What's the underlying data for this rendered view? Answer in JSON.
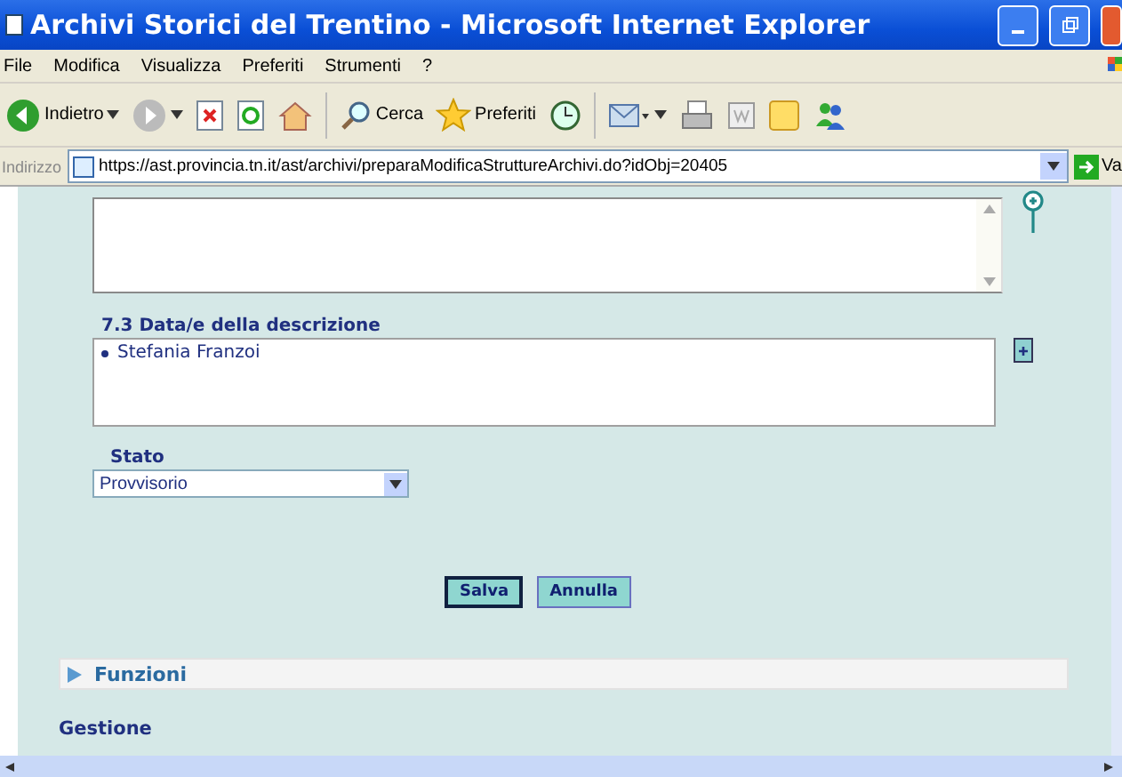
{
  "window": {
    "title": "Archivi Storici del Trentino - Microsoft Internet Explorer"
  },
  "menu": [
    "File",
    "Modifica",
    "Visualizza",
    "Preferiti",
    "Strumenti",
    "?"
  ],
  "toolbar": [
    {
      "kind": "back",
      "label": "Indietro"
    },
    {
      "kind": "forward"
    },
    {
      "kind": "stop"
    },
    {
      "kind": "refresh"
    },
    {
      "kind": "home"
    },
    {
      "kind": "search",
      "label": "Cerca"
    },
    {
      "kind": "favorites",
      "label": "Preferiti"
    },
    {
      "kind": "history"
    },
    {
      "kind": "mail"
    },
    {
      "kind": "print"
    },
    {
      "kind": "edit"
    },
    {
      "kind": "notes"
    },
    {
      "kind": "messenger"
    }
  ],
  "address": {
    "label": "Indirizzo",
    "value": "https://ast.provincia.tn.it/ast/archivi/preparaModificaStruttureArchivi.do?idObj=20405",
    "go": "Va"
  },
  "date_field": {
    "label": "7.3 Data/e della descrizione",
    "items": [
      "Stefania Franzoi"
    ]
  },
  "stato": {
    "label": "Stato",
    "value": "Provvisorio"
  },
  "buttons": [
    {
      "label": "Salva",
      "selected": true
    },
    {
      "label": "Annulla",
      "selected": false
    }
  ],
  "sections": [
    {
      "label": "Funzioni",
      "expanded": false
    }
  ],
  "footer_heading": "Gestione"
}
